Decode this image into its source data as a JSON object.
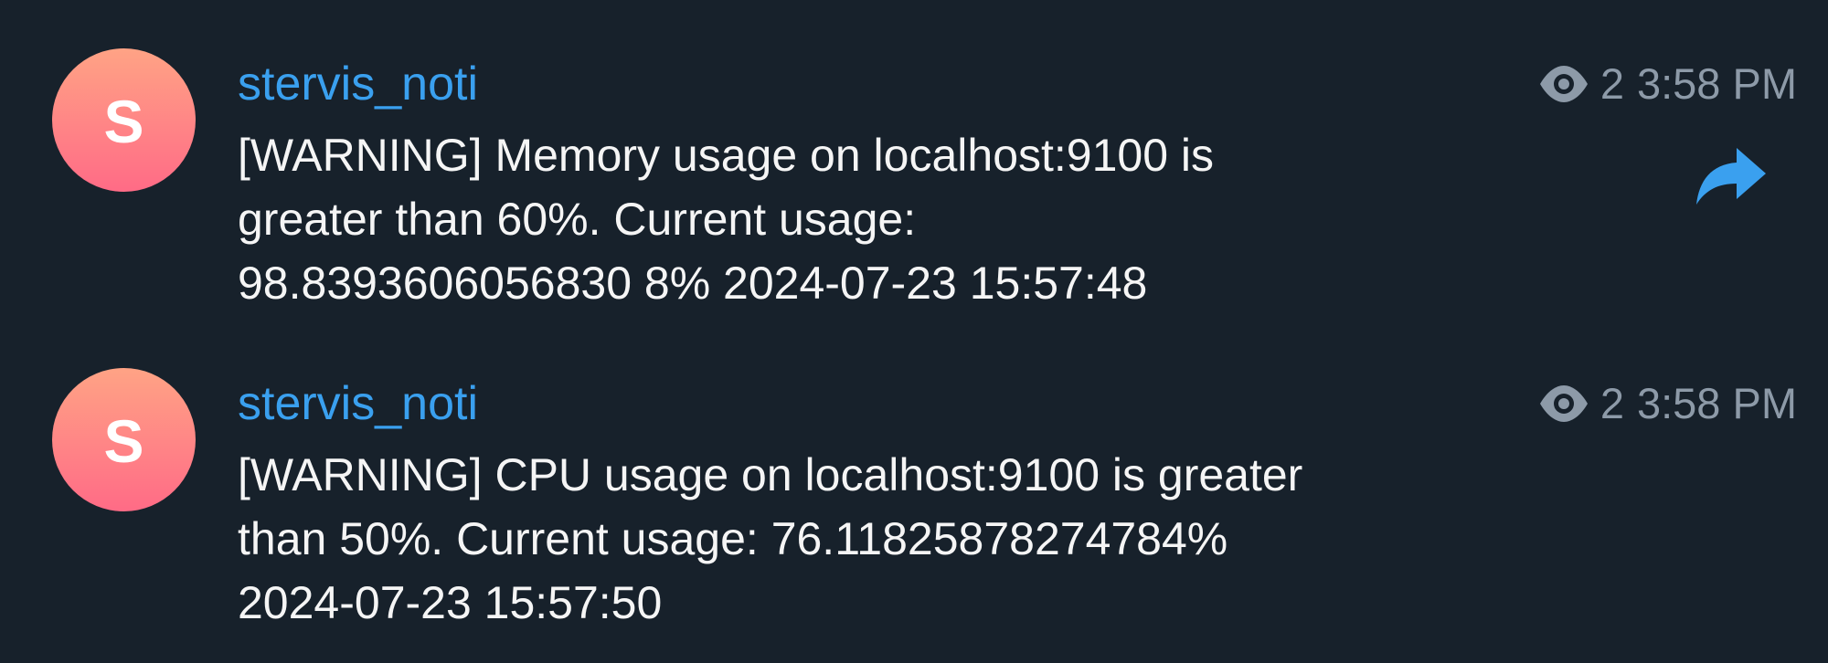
{
  "messages": [
    {
      "avatar_letter": "S",
      "sender": "stervis_noti",
      "text": "[WARNING] Memory usage on localhost:9100 is\ngreater than 60%. Current usage:\n98.8393606056830 8% 2024-07-23 15:57:48",
      "views": "2",
      "time": "3:58 PM",
      "has_forward": true
    },
    {
      "avatar_letter": "S",
      "sender": "stervis_noti",
      "text": "[WARNING] CPU usage on localhost:9100 is greater\nthan 50%. Current usage: 76.11825878274784%\n2024-07-23 15:57:50",
      "views": "2",
      "time": "3:58 PM",
      "has_forward": false
    }
  ],
  "colors": {
    "background": "#17212b",
    "sender_name": "#3aa0ef",
    "message_text": "#f5f5f5",
    "meta_text": "#8d9aa8",
    "avatar_gradient_top": "#ffa385",
    "avatar_gradient_bottom": "#ff6b86",
    "forward_icon": "#3aa0ef"
  },
  "icons": {
    "views": "eye-icon",
    "forward": "forward-arrow-icon"
  }
}
